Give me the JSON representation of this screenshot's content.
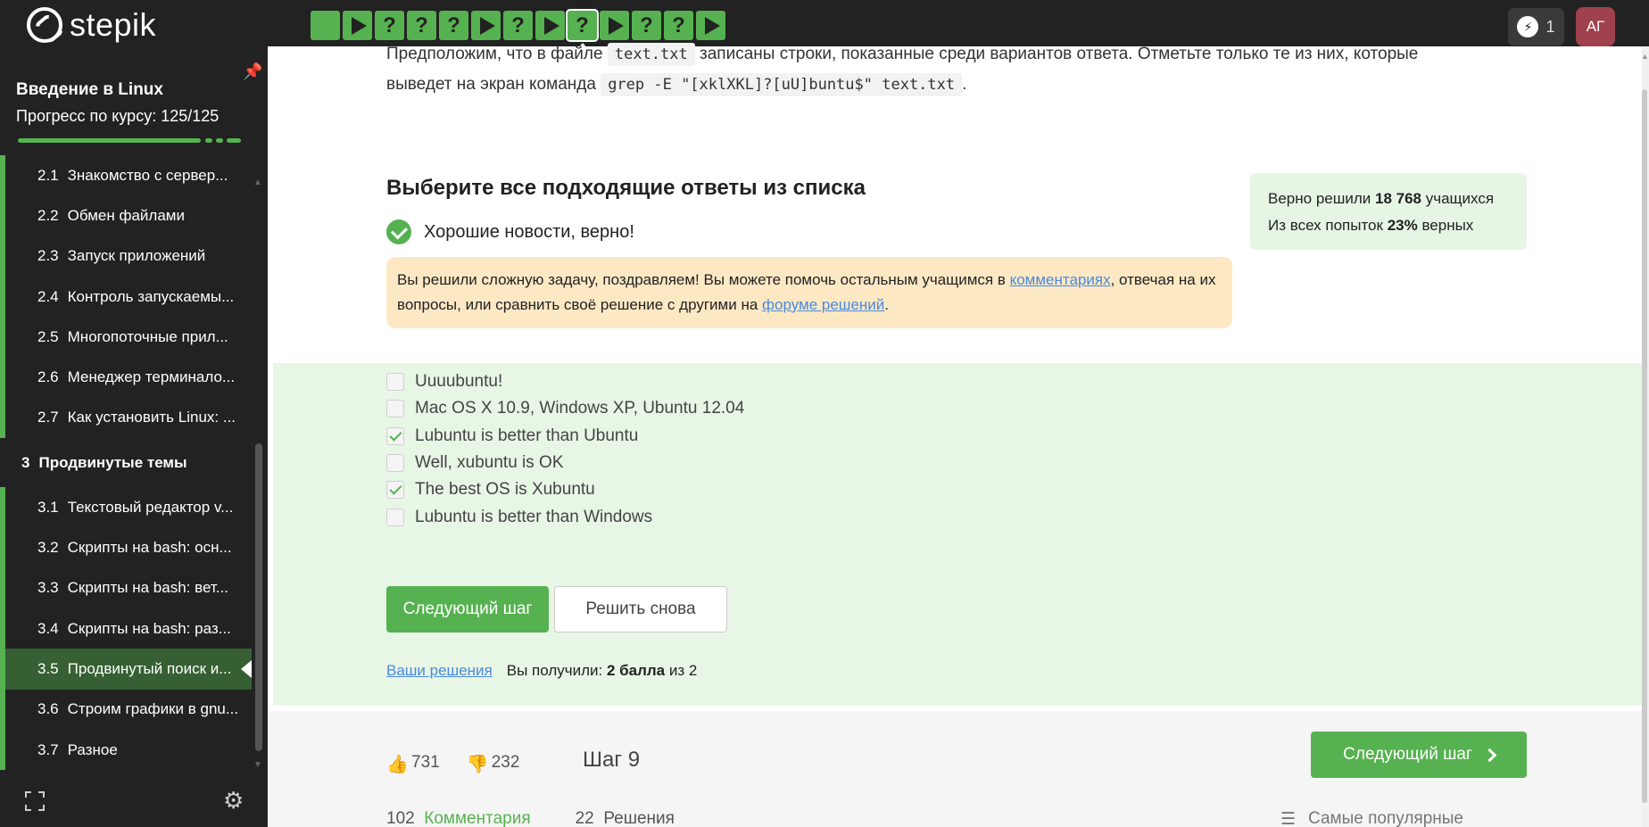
{
  "app": {
    "logo_text": "stepik"
  },
  "topbar": {
    "steps": [
      {
        "type": "done"
      },
      {
        "type": "play"
      },
      {
        "type": "quiz",
        "label": "?"
      },
      {
        "type": "quiz",
        "label": "?"
      },
      {
        "type": "quiz",
        "label": "?"
      },
      {
        "type": "play"
      },
      {
        "type": "quiz",
        "label": "?"
      },
      {
        "type": "play"
      },
      {
        "type": "quiz",
        "label": "?",
        "current": true
      },
      {
        "type": "play"
      },
      {
        "type": "quiz",
        "label": "?"
      },
      {
        "type": "quiz",
        "label": "?"
      },
      {
        "type": "play"
      }
    ],
    "energy_count": "1",
    "avatar_initials": "АГ"
  },
  "sidebar": {
    "course_title": "Введение в Linux",
    "progress_label": "Прогресс по курсу:  125/125",
    "items": [
      {
        "num": "2.1",
        "label": "Знакомство с сервер..."
      },
      {
        "num": "2.2",
        "label": "Обмен файлами"
      },
      {
        "num": "2.3",
        "label": "Запуск приложений"
      },
      {
        "num": "2.4",
        "label": "Контроль запускаемы..."
      },
      {
        "num": "2.5",
        "label": "Многопоточные прил..."
      },
      {
        "num": "2.6",
        "label": "Менеджер терминало..."
      },
      {
        "num": "2.7",
        "label": "Как установить Linux: ..."
      },
      {
        "num": "3",
        "label": "Продвинутые темы",
        "section": true
      },
      {
        "num": "3.1",
        "label": "Текстовый редактор v..."
      },
      {
        "num": "3.2",
        "label": "Скрипты на bash: осн..."
      },
      {
        "num": "3.3",
        "label": "Скрипты на bash: вет..."
      },
      {
        "num": "3.4",
        "label": "Скрипты на bash: раз..."
      },
      {
        "num": "3.5",
        "label": "Продвинутый поиск и...",
        "active": true
      },
      {
        "num": "3.6",
        "label": "Строим графики в gnu..."
      },
      {
        "num": "3.7",
        "label": "Разное"
      }
    ]
  },
  "question": {
    "line1_a": "Предположим, что в файле ",
    "line1_code": "text.txt",
    "line1_b": " записаны строки, показанные среди вариантов ответа. Отметьте только те из них, которые",
    "line2_a": "выведет на экран команда ",
    "line2_code": "grep -E \"[xklXKL]?[uU]buntu$\" text.txt",
    "line2_b": "."
  },
  "quiz": {
    "title": "Выберите все подходящие ответы из списка",
    "success_text": "Хорошие новости, верно!",
    "congrats_a": "Вы решили сложную задачу, поздравляем! Вы можете помочь остальным учащимся в ",
    "congrats_link1": "комментариях",
    "congrats_b": ", отвечая на их вопросы, или сравнить своё решение с другими на ",
    "congrats_link2": "форуме решений",
    "congrats_c": ".",
    "stats_line1_a": "Верно решили ",
    "stats_line1_b": "18 768",
    "stats_line1_c": " учащихся",
    "stats_line2_a": "Из всех попыток ",
    "stats_line2_b": "23%",
    "stats_line2_c": " верных",
    "options": [
      {
        "label": "Uuuubuntu!",
        "checked": false
      },
      {
        "label": "Mac OS X 10.9, Windows XP, Ubuntu 12.04",
        "checked": false
      },
      {
        "label": "Lubuntu is better than Ubuntu",
        "checked": true
      },
      {
        "label": "Well, xubuntu is OK",
        "checked": false
      },
      {
        "label": "The best OS is Xubuntu",
        "checked": true
      },
      {
        "label": "Lubuntu is better than Windows",
        "checked": false
      }
    ],
    "next_button": "Следующий шаг",
    "retry_button": "Решить снова",
    "your_solutions": "Ваши решения",
    "score_a": "Вы получили: ",
    "score_b": "2 балла",
    "score_c": " из 2"
  },
  "footer": {
    "likes": "731",
    "dislikes": "232",
    "step_label": "Шаг 9",
    "next_button": "Следующий шаг",
    "comments_count": "102",
    "comments_label": "Комментария",
    "solutions_count": "22",
    "solutions_label": "Решения",
    "sort_label": "Самые популярные"
  }
}
